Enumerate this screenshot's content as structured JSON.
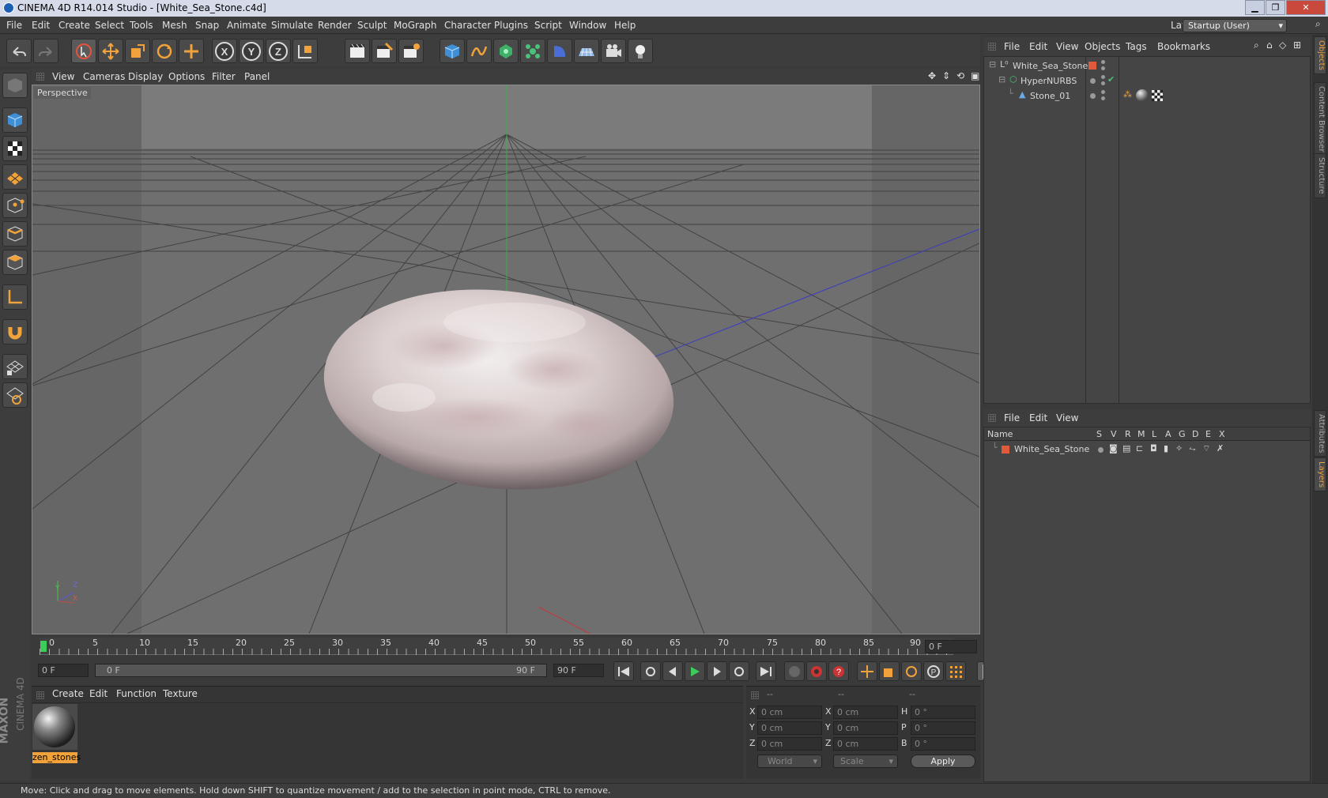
{
  "titlebar": {
    "title": "CINEMA 4D R14.014 Studio - [White_Sea_Stone.c4d]",
    "min": "▁",
    "max": "❐",
    "close": "✕"
  },
  "menubar": {
    "items": [
      "File",
      "Edit",
      "Create",
      "Select",
      "Tools",
      "Mesh",
      "Snap",
      "Animate",
      "Simulate",
      "Render",
      "Sculpt",
      "MoGraph",
      "Character",
      "Plugins",
      "Script",
      "Window",
      "Help"
    ],
    "layout_label": "Layout:",
    "layout_value": "Startup (User)"
  },
  "viewport": {
    "menu": [
      "View",
      "Cameras",
      "Display",
      "Options",
      "Filter",
      "Panel"
    ],
    "label": "Perspective",
    "axis_y": "Y",
    "axis_z": "Z",
    "axis_x": "X"
  },
  "timeline": {
    "ticks": [
      "0",
      "5",
      "10",
      "15",
      "20",
      "25",
      "30",
      "35",
      "40",
      "45",
      "50",
      "55",
      "60",
      "65",
      "70",
      "75",
      "80",
      "85",
      "90"
    ],
    "current_frame": "0 F",
    "start_field": "0 F",
    "range_start": "0 F",
    "range_end": "90 F",
    "end_field": "90 F"
  },
  "materials": {
    "menu": [
      "Create",
      "Edit",
      "Function",
      "Texture"
    ],
    "items": [
      {
        "name": "zen_stones"
      }
    ]
  },
  "coordinates": {
    "headers": [
      "--",
      "--",
      "--"
    ],
    "rows": [
      {
        "a": "X",
        "av": "0 cm",
        "b": "X",
        "bv": "0 cm",
        "c": "H",
        "cv": "0 °"
      },
      {
        "a": "Y",
        "av": "0 cm",
        "b": "Y",
        "bv": "0 cm",
        "c": "P",
        "cv": "0 °"
      },
      {
        "a": "Z",
        "av": "0 cm",
        "b": "Z",
        "bv": "0 cm",
        "c": "B",
        "cv": "0 °"
      }
    ],
    "mode": "World",
    "scale": "Scale",
    "apply": "Apply"
  },
  "objects": {
    "menu": [
      "File",
      "Edit",
      "View",
      "Objects",
      "Tags",
      "Bookmarks"
    ],
    "tree": [
      {
        "name": "White_Sea_Stone",
        "level": 0
      },
      {
        "name": "HyperNURBS",
        "level": 1
      },
      {
        "name": "Stone_01",
        "level": 2
      }
    ]
  },
  "layers": {
    "menu": [
      "File",
      "Edit",
      "View"
    ],
    "name_header": "Name",
    "columns": [
      "S",
      "V",
      "R",
      "M",
      "L",
      "A",
      "G",
      "D",
      "E",
      "X"
    ],
    "rows": [
      {
        "name": "White_Sea_Stone"
      }
    ]
  },
  "sidetabs": [
    "Objects",
    "Content Browser",
    "Structure",
    "Attributes",
    "Layers"
  ],
  "status": "Move: Click and drag to move elements. Hold down SHIFT to quantize movement / add to the selection in point mode, CTRL to remove.",
  "brand": {
    "line1": "MAXON",
    "line2": "CINEMA 4D"
  },
  "colors": {
    "accent": "#f2a23a",
    "layer_red": "#e05a3b",
    "grid_x": "#c23a3a",
    "grid_y": "#35b04a",
    "grid_z": "#3a3ac2"
  }
}
